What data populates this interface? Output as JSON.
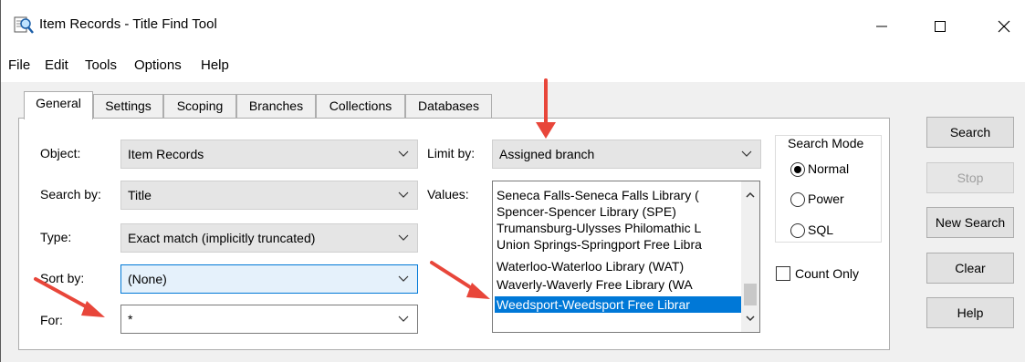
{
  "window": {
    "title": "Item Records - Title Find Tool",
    "controls": {
      "minimize": "—",
      "maximize": "☐",
      "close": "✕"
    }
  },
  "menu": [
    "File",
    "Edit",
    "Tools",
    "Options",
    "Help"
  ],
  "tabs": [
    "General",
    "Settings",
    "Scoping",
    "Branches",
    "Collections",
    "Databases"
  ],
  "form": {
    "object_label": "Object:",
    "object_value": "Item Records",
    "searchby_label": "Search by:",
    "searchby_value": "Title",
    "type_label": "Type:",
    "type_value": "Exact match (implicitly truncated)",
    "sortby_label": "Sort by:",
    "sortby_value": "(None)",
    "for_label": "For:",
    "for_value": "*",
    "limitby_label": "Limit by:",
    "limitby_value": "Assigned branch",
    "values_label": "Values:"
  },
  "values_list": [
    "Seneca Falls-Seneca Falls Library (",
    "Spencer-Spencer Library (SPE)",
    "Trumansburg-Ulysses Philomathic L",
    "Union Springs-Springport Free Libra",
    "Waterloo-Waterloo Library (WAT)",
    "Waverly-Waverly Free Library (WA",
    "Weedsport-Weedsport Free Librar"
  ],
  "selected_value": "Weedsport-Weedsport Free Librar",
  "search_mode": {
    "title": "Search Mode",
    "options": [
      "Normal",
      "Power",
      "SQL"
    ],
    "selected": "Normal"
  },
  "count_only": {
    "label": "Count Only",
    "checked": false
  },
  "buttons": {
    "search": "Search",
    "stop": "Stop",
    "new_search": "New Search",
    "clear": "Clear",
    "help": "Help"
  },
  "colors": {
    "selection": "#0078d7",
    "annotation_arrow": "#e8463a"
  }
}
